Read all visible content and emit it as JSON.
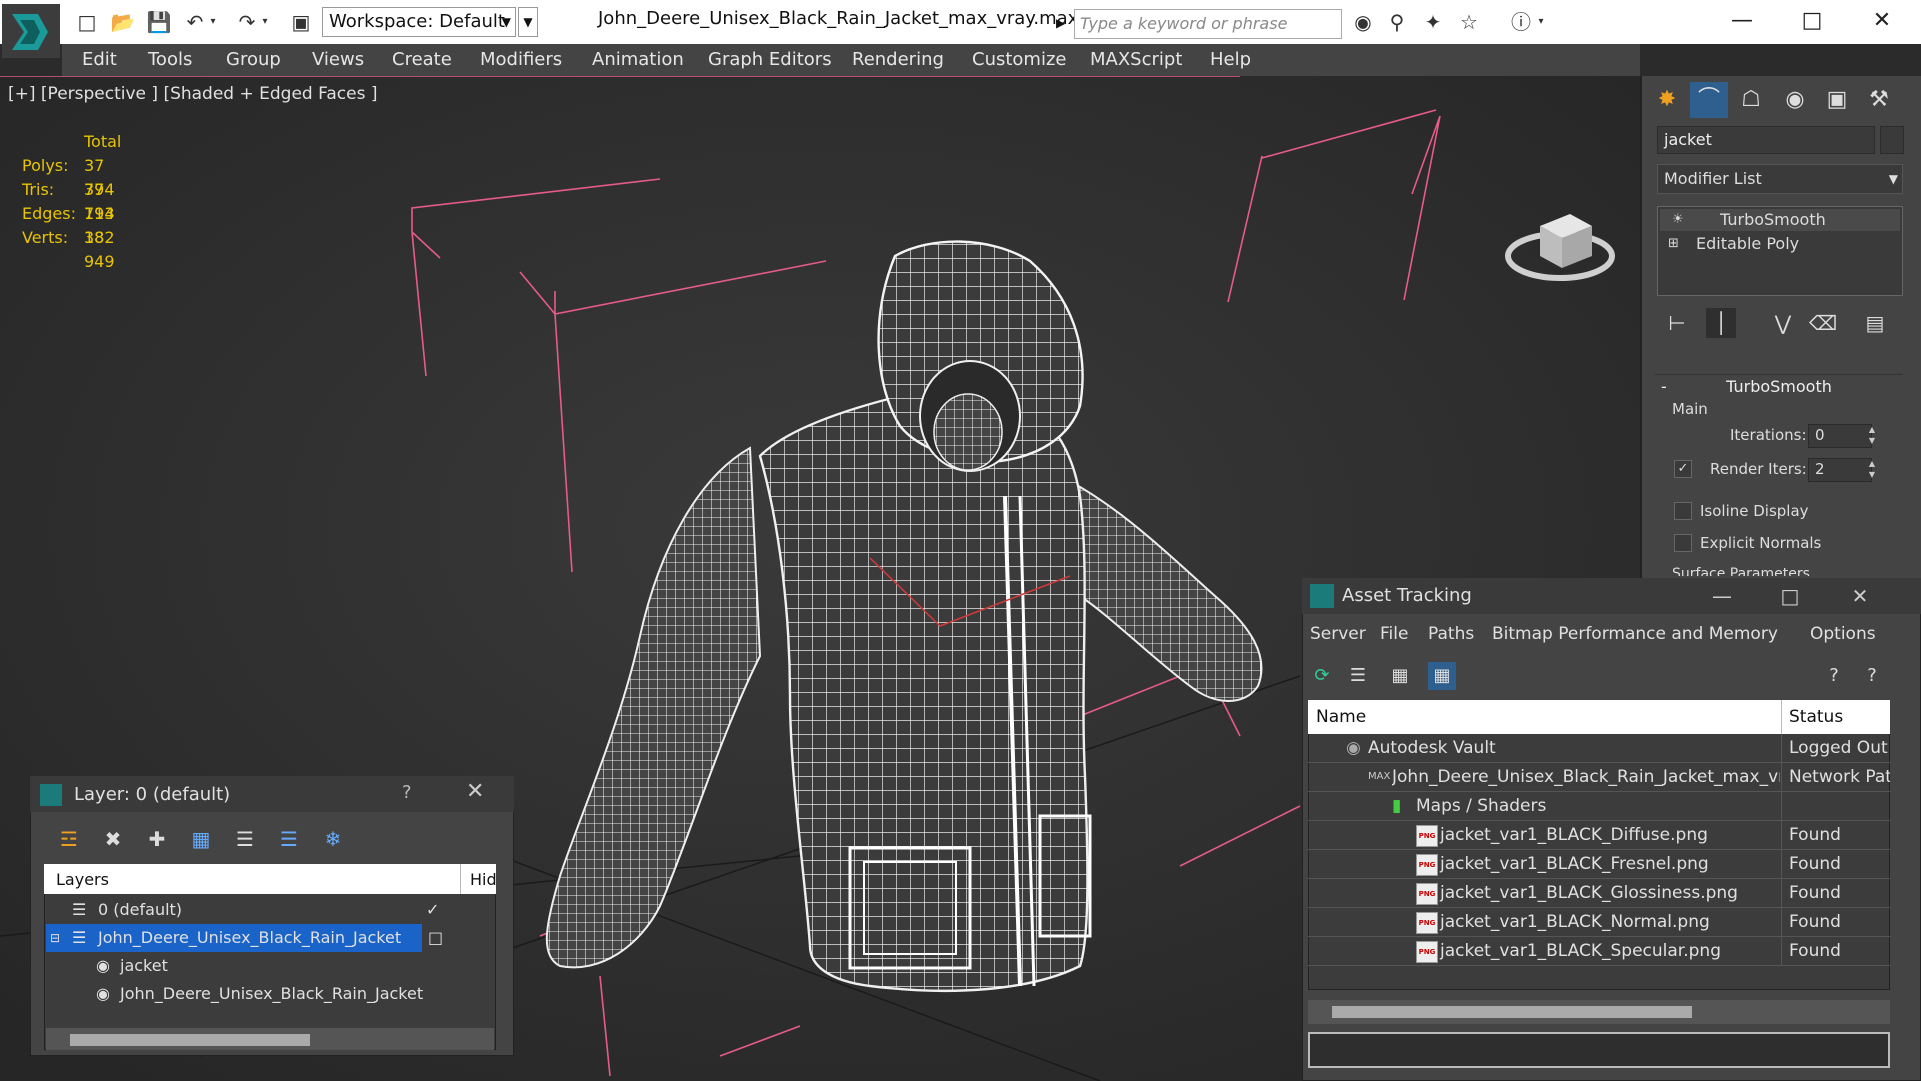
{
  "titlebar": {
    "workspace": "Workspace: Default",
    "filename": "John_Deere_Unisex_Black_Rain_Jacket_max_vray.max",
    "search_placeholder": "Type a keyword or phrase"
  },
  "menu": [
    "Edit",
    "Tools",
    "Group",
    "Views",
    "Create",
    "Modifiers",
    "Animation",
    "Graph Editors",
    "Rendering",
    "Customize",
    "MAXScript",
    "Help"
  ],
  "viewport": {
    "label": "[+] [Perspective ] [Shaded + Edged Faces ]",
    "stats_header": "Total",
    "stats": [
      {
        "k": "Polys:",
        "v": "37 794"
      },
      {
        "k": "Tris:",
        "v": "37 794"
      },
      {
        "k": "Edges:",
        "v": "113 382"
      },
      {
        "k": "Verts:",
        "v": "18 949"
      }
    ]
  },
  "command_panel": {
    "object_name": "jacket",
    "modifier_list": "Modifier List",
    "stack": [
      "TurboSmooth",
      "Editable Poly"
    ],
    "rollout_title": "TurboSmooth",
    "group_main": "Main",
    "iterations_label": "Iterations:",
    "iterations_value": "0",
    "render_iters_label": "Render Iters:",
    "render_iters_value": "2",
    "isoline_label": "Isoline Display",
    "explicit_label": "Explicit Normals",
    "cut_off_label": "Surface Parameters"
  },
  "asset_tracking": {
    "title": "Asset Tracking",
    "menu": [
      "Server",
      "File",
      "Paths",
      "Bitmap Performance and Memory",
      "Options"
    ],
    "col_name": "Name",
    "col_status": "Status",
    "rows": [
      {
        "name": "Autodesk Vault",
        "status": "Logged Out"
      },
      {
        "name": "John_Deere_Unisex_Black_Rain_Jacket_max_vray....",
        "status": "Network Path"
      },
      {
        "name": "Maps / Shaders",
        "status": ""
      },
      {
        "name": "jacket_var1_BLACK_Diffuse.png",
        "status": "Found"
      },
      {
        "name": "jacket_var1_BLACK_Fresnel.png",
        "status": "Found"
      },
      {
        "name": "jacket_var1_BLACK_Glossiness.png",
        "status": "Found"
      },
      {
        "name": "jacket_var1_BLACK_Normal.png",
        "status": "Found"
      },
      {
        "name": "jacket_var1_BLACK_Specular.png",
        "status": "Found"
      }
    ]
  },
  "layer_window": {
    "title": "Layer: 0 (default)",
    "help": "?",
    "col_layers": "Layers",
    "col_hide": "Hid",
    "rows": [
      "0 (default)",
      "John_Deere_Unisex_Black_Rain_Jacket",
      "jacket",
      "John_Deere_Unisex_Black_Rain_Jacket"
    ]
  },
  "colors": {
    "accent_blue": "#1a63c8",
    "stats_yellow": "#e8c400",
    "bbox_pink": "#e65a8c"
  }
}
